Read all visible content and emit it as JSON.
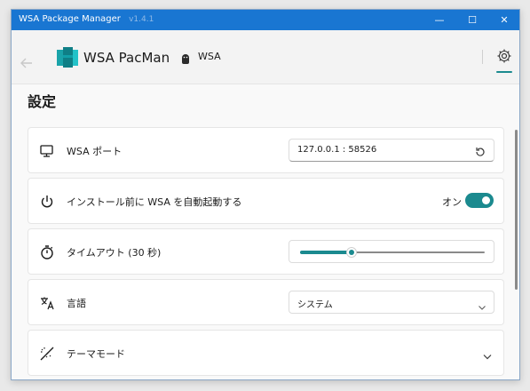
{
  "window": {
    "title": "WSA Package Manager",
    "version": "v1.4.1",
    "controls": {
      "minimize": "—",
      "maximize": "☐",
      "close": "✕"
    }
  },
  "header": {
    "back_icon": "back-arrow-icon",
    "app_name": "WSA PacMan",
    "wsa_label": "WSA",
    "settings_icon": "gear-icon"
  },
  "page": {
    "title": "設定"
  },
  "settings": {
    "port": {
      "label": "WSA ポート",
      "value": "127.0.0.1 :  58526",
      "icon": "monitor-icon",
      "reset_icon": "reset-icon"
    },
    "autostart": {
      "label": "インストール前に WSA を自動起動する",
      "state_label": "オン",
      "on": true,
      "icon": "power-icon"
    },
    "timeout": {
      "label": "タイムアウト (30 秒)",
      "value_seconds": 30,
      "fraction": 0.28,
      "icon": "timer-icon"
    },
    "language": {
      "label": "言語",
      "selected": "システム",
      "icon": "translate-icon"
    },
    "theme": {
      "label": "テーマモード",
      "icon": "theme-icon"
    }
  },
  "colors": {
    "accent": "#1b8a8f",
    "titlebar": "#1976d2"
  }
}
